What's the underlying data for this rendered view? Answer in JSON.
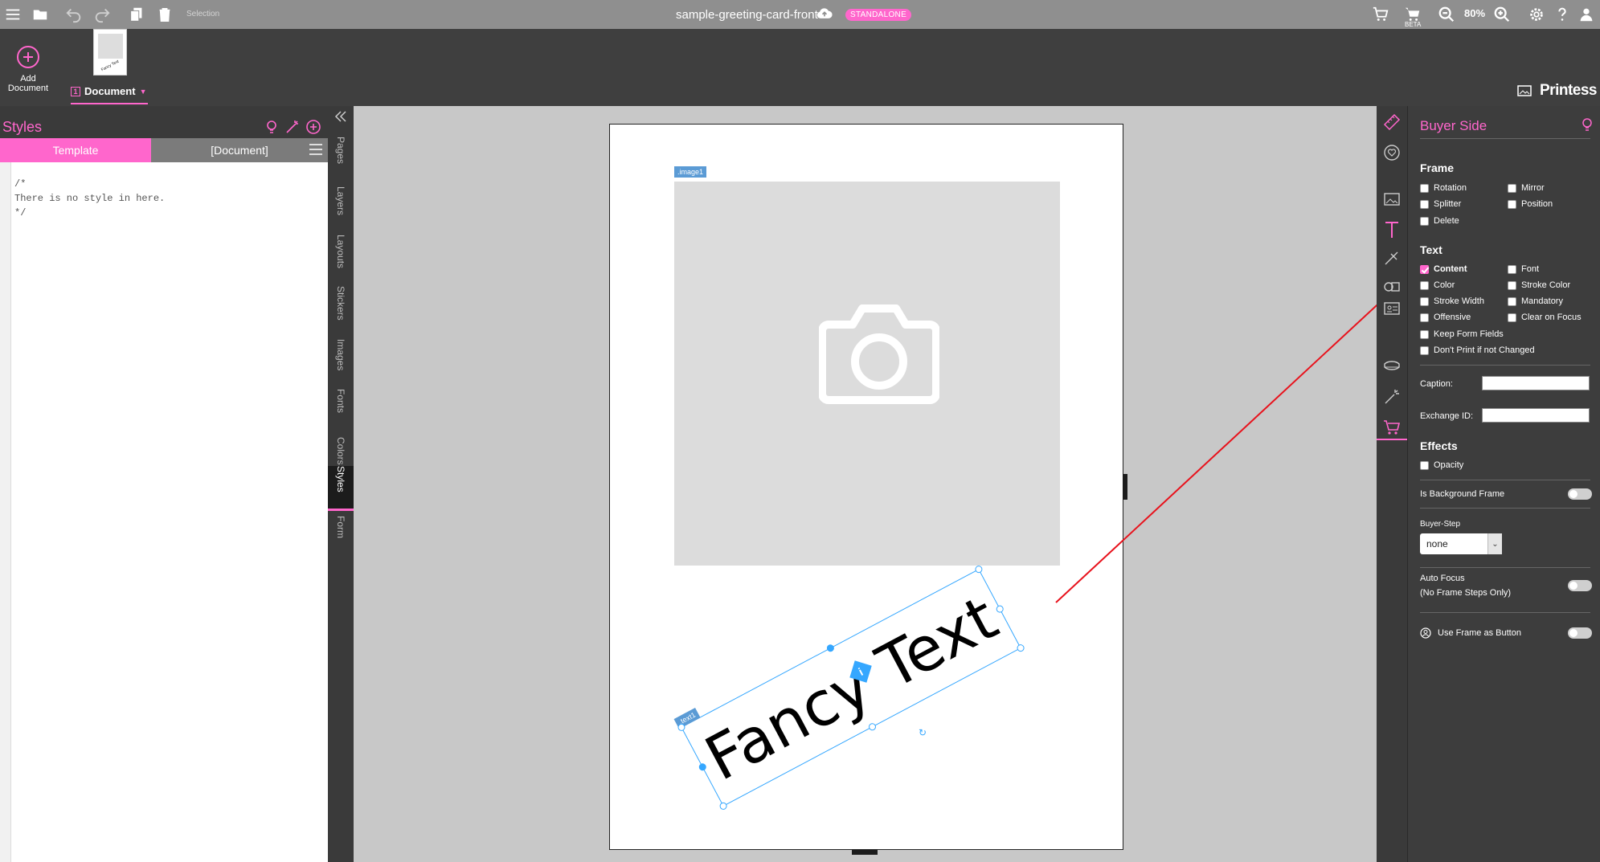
{
  "toolbar": {
    "selection_label": "Selection",
    "document_title": "sample-greeting-card-front",
    "mode_badge": "STANDALONE",
    "beta_label": "BETA",
    "zoom_level": "80%"
  },
  "docbar": {
    "add_document_label": "Add Document",
    "document_tab_number": "1",
    "document_tab_label": "Document",
    "thumb_text": "Fancy Text",
    "brand": "Printess"
  },
  "styles_panel": {
    "title": "Styles",
    "tab_template": "Template",
    "tab_document": "[Document]",
    "code": "/*\nThere is no style in here.\n*/"
  },
  "vertical_tabs": [
    "Pages",
    "Layers",
    "Layouts",
    "Stickers",
    "Images",
    "Fonts",
    "Colors",
    "Styles",
    "Form"
  ],
  "active_vertical_tab": "Styles",
  "canvas": {
    "image_frame_label": ".image1",
    "text_frame_label": ".text1",
    "text_content": "Fancy Text"
  },
  "buyer_side": {
    "title": "Buyer Side",
    "frame_section": "Frame",
    "frame_options": [
      {
        "label": "Rotation",
        "checked": false
      },
      {
        "label": "Mirror",
        "checked": false
      },
      {
        "label": "Splitter",
        "checked": false
      },
      {
        "label": "Position",
        "checked": false
      },
      {
        "label": "Delete",
        "checked": false
      }
    ],
    "text_section": "Text",
    "text_options": [
      {
        "label": "Content",
        "checked": true
      },
      {
        "label": "Font",
        "checked": false
      },
      {
        "label": "Color",
        "checked": false
      },
      {
        "label": "Stroke Color",
        "checked": false
      },
      {
        "label": "Stroke Width",
        "checked": false
      },
      {
        "label": "Mandatory",
        "checked": false
      },
      {
        "label": "Offensive",
        "checked": false
      },
      {
        "label": "Clear on Focus",
        "checked": false
      },
      {
        "label": "Keep Form Fields",
        "checked": false
      },
      {
        "label": "Don't Print if not Changed",
        "checked": false
      }
    ],
    "caption_label": "Caption:",
    "caption_value": "",
    "exchange_id_label": "Exchange ID:",
    "exchange_id_value": "",
    "effects_section": "Effects",
    "opacity_label": "Opacity",
    "is_background_frame_label": "Is Background Frame",
    "buyer_step_label": "Buyer-Step",
    "buyer_step_value": "none",
    "auto_focus_label": "Auto Focus",
    "auto_focus_sub": "(No Frame Steps Only)",
    "use_frame_as_button_label": "Use Frame as Button"
  },
  "colors": {
    "accent": "#ff66cc",
    "selection_blue": "#35a7ff",
    "annotation_arrow": "#e8121c"
  }
}
